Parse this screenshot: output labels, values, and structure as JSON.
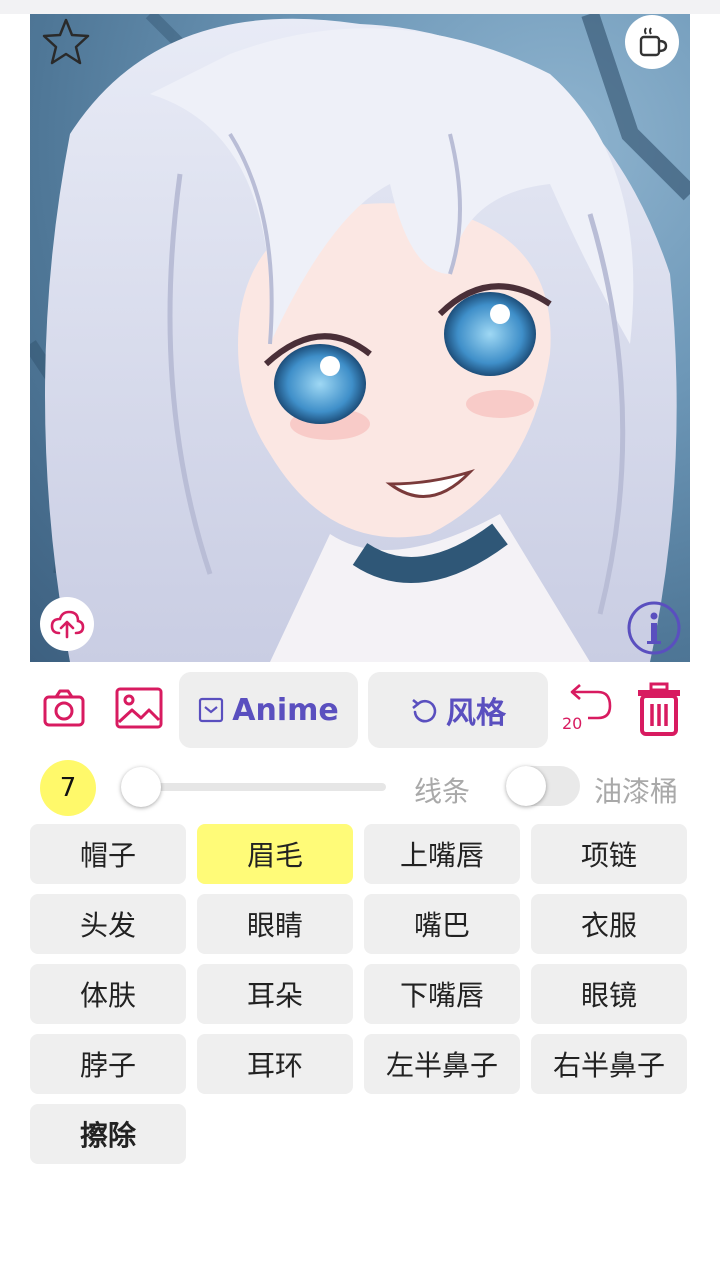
{
  "colors": {
    "accent_pink": "#d81b60",
    "accent_purple": "#5a4fbf",
    "selected_yellow": "#fffb78",
    "button_gray": "#efefef"
  },
  "image": {
    "icons": [
      "star-icon",
      "coffee-cup-icon",
      "cloud-upload-icon",
      "info-icon"
    ]
  },
  "toolbar": {
    "camera_icon": "camera-icon",
    "gallery_icon": "image-icon",
    "anime_label": "Anime",
    "style_label": "风格",
    "undo_count": "20",
    "delete_icon": "trash-icon"
  },
  "brush": {
    "size": "7",
    "size_level": 0.0,
    "line_label": "线条",
    "fill_label": "油漆桶",
    "fill_enabled": false
  },
  "parts": [
    {
      "label": "帽子"
    },
    {
      "label": "眉毛",
      "selected": true
    },
    {
      "label": "上嘴唇"
    },
    {
      "label": "项链"
    },
    {
      "label": "头发"
    },
    {
      "label": "眼睛"
    },
    {
      "label": "嘴巴"
    },
    {
      "label": "衣服"
    },
    {
      "label": "体肤"
    },
    {
      "label": "耳朵"
    },
    {
      "label": "下嘴唇"
    },
    {
      "label": "眼镜"
    },
    {
      "label": "脖子"
    },
    {
      "label": "耳环"
    },
    {
      "label": "左半鼻子"
    },
    {
      "label": "右半鼻子"
    },
    {
      "label": "擦除"
    }
  ]
}
